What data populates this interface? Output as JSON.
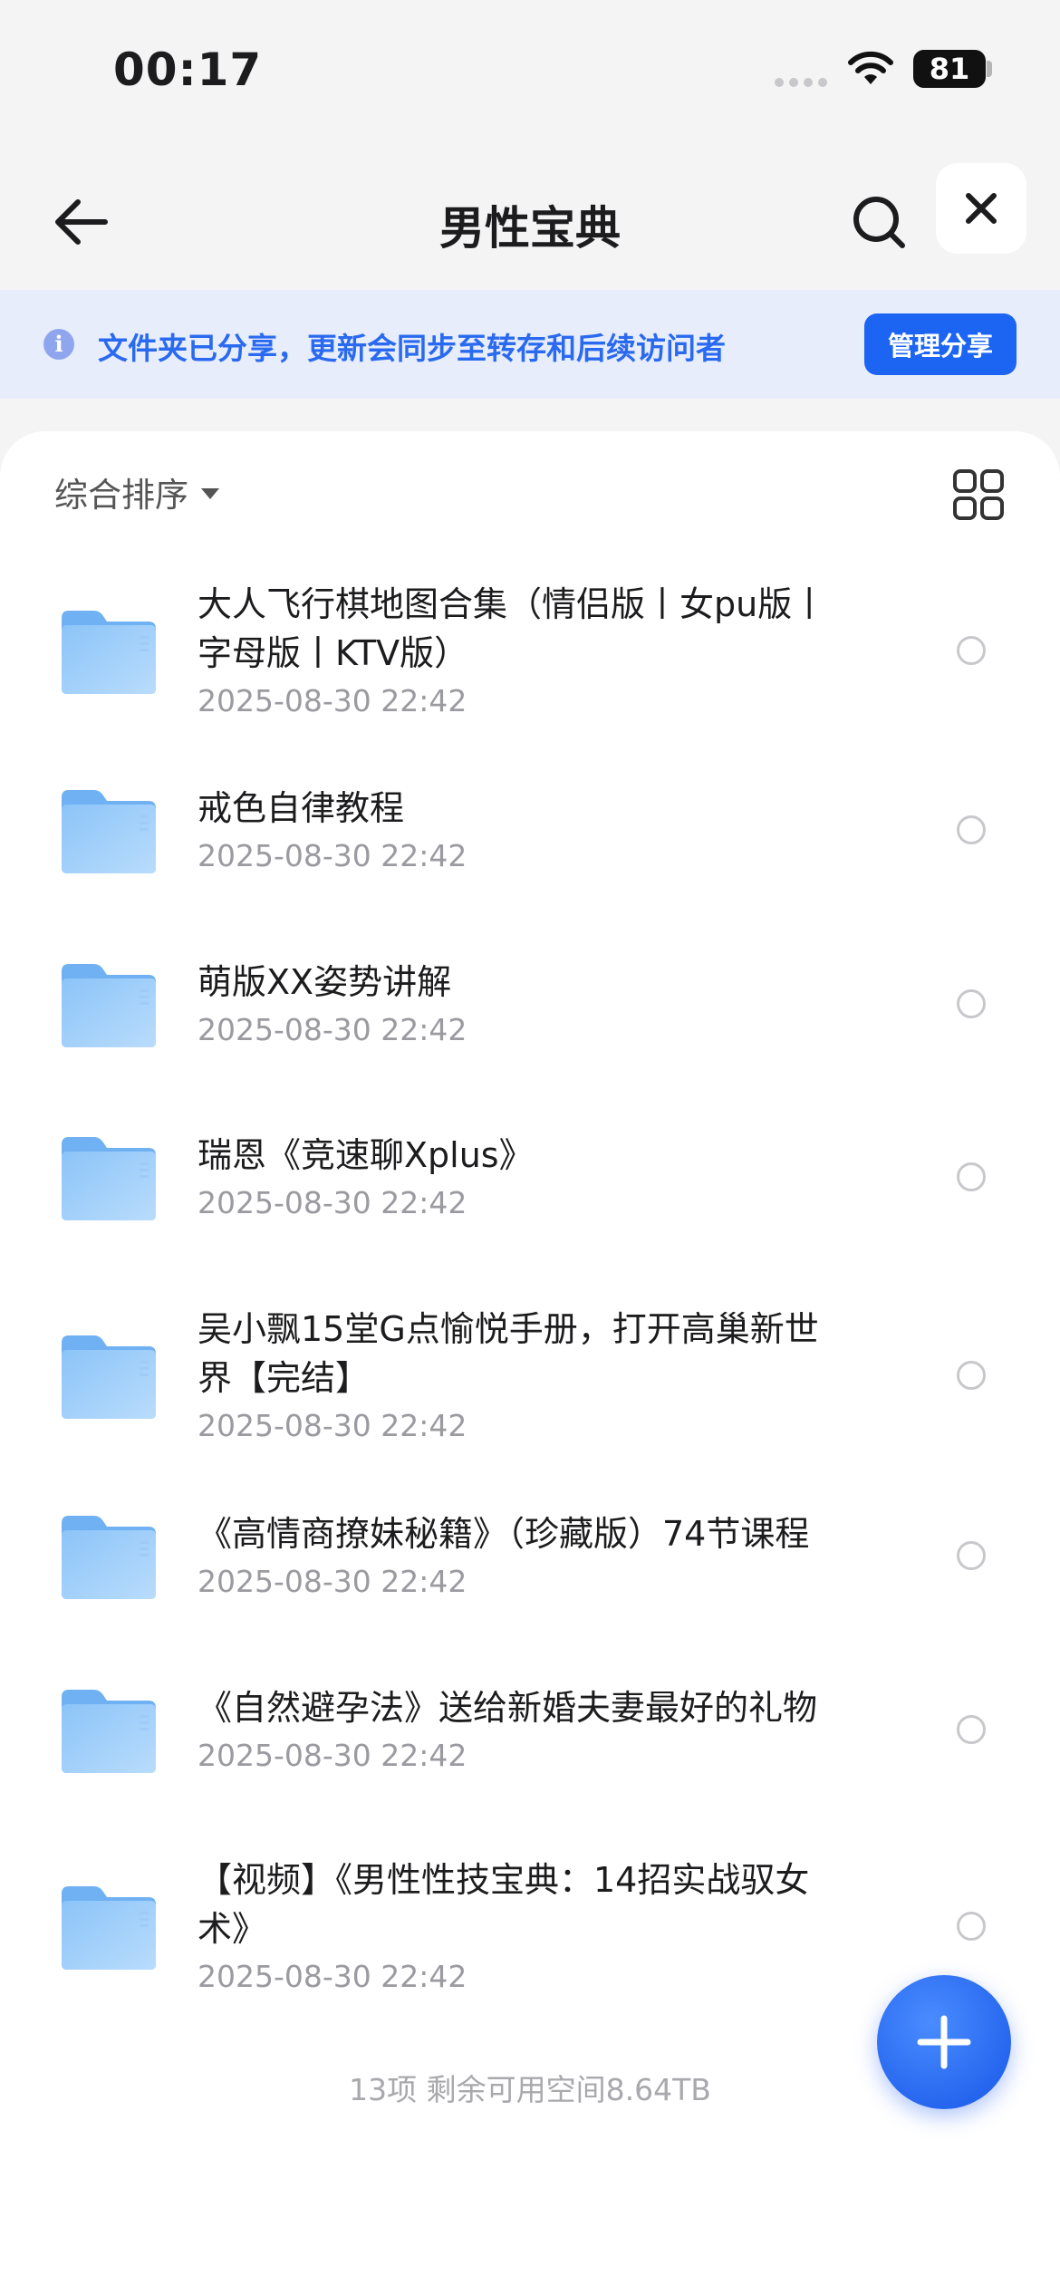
{
  "status": {
    "time": "00:17",
    "battery": "81"
  },
  "nav": {
    "title": "男性宝典"
  },
  "banner": {
    "text": "文件夹已分享，更新会同步至转存和后续访问者",
    "button": "管理分享"
  },
  "sort": {
    "label": "综合排序"
  },
  "items": [
    {
      "title": "大人飞行棋地图合集（情侣版丨女pu版丨字母版丨KTV版）",
      "date": "2025-08-30 22:42"
    },
    {
      "title": "戒色自律教程",
      "date": "2025-08-30 22:42"
    },
    {
      "title": "萌版XX姿势讲解",
      "date": "2025-08-30 22:42"
    },
    {
      "title": "瑞恩《竞速聊Xplus》",
      "date": "2025-08-30 22:42"
    },
    {
      "title": "吴小飘15堂G点愉悦手册，打开高巢新世界【完结】",
      "date": "2025-08-30 22:42"
    },
    {
      "title": "《高情商撩妹秘籍》（珍藏版）74节课程",
      "date": "2025-08-30 22:42"
    },
    {
      "title": "《自然避孕法》送给新婚夫妻最好的礼物",
      "date": "2025-08-30 22:42"
    },
    {
      "title": "【视频】《男性性技宝典：14招实战驭女术》",
      "date": "2025-08-30 22:42"
    }
  ],
  "footer": "13项 剩余可用空间8.64TB",
  "colors": {
    "accent": "#1c64f2",
    "banner_bg": "#e8edfb",
    "folder": "#8cc4f8"
  }
}
